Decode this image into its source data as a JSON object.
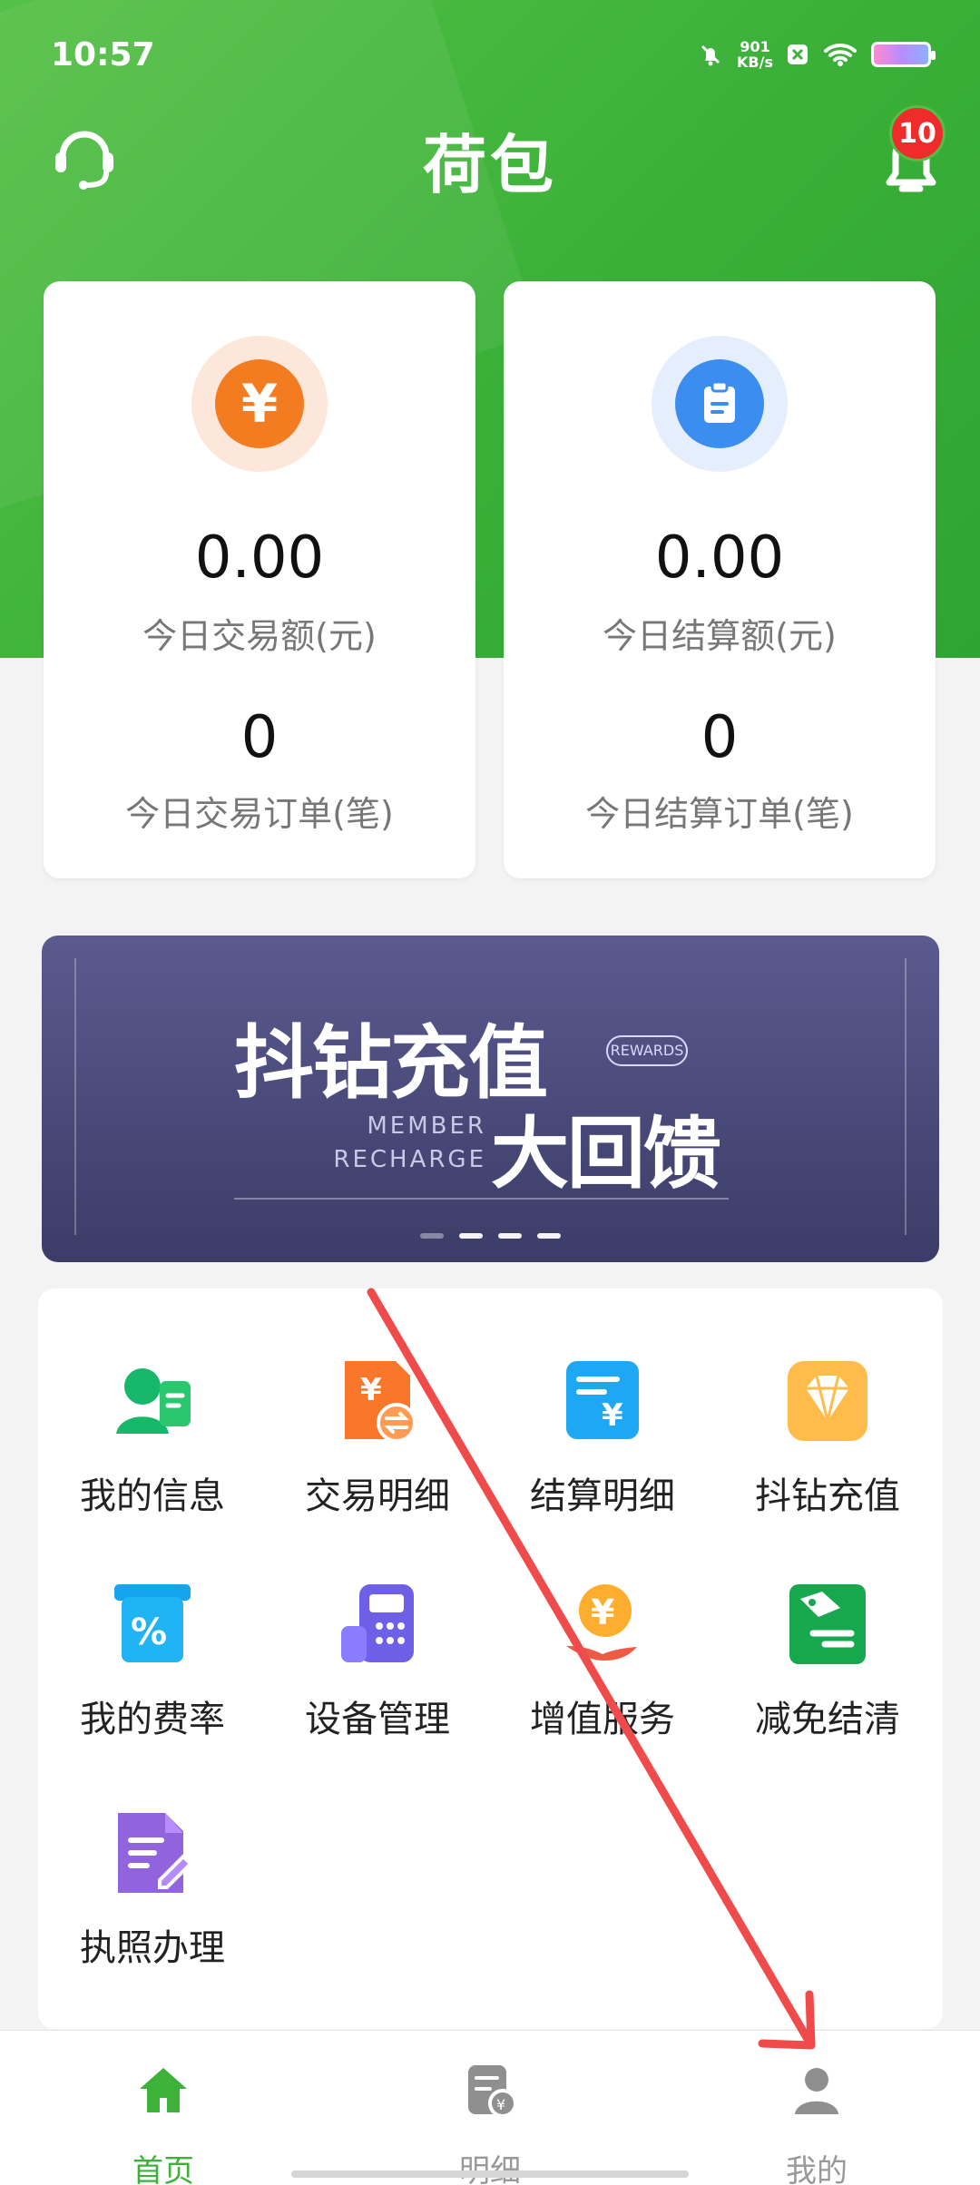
{
  "status_bar": {
    "time": "10:57",
    "network_speed_value": "901",
    "network_speed_unit": "KB/s"
  },
  "header": {
    "title": "荷包",
    "notification_count": "10",
    "support_icon": "headset-icon",
    "bell_icon": "bell-icon"
  },
  "summary_cards": [
    {
      "amount": "0.00",
      "amount_label": "今日交易额(元)",
      "count": "0",
      "count_label": "今日交易订单(笔)",
      "icon": "yuan-icon",
      "accent": "#f47c20"
    },
    {
      "amount": "0.00",
      "amount_label": "今日结算额(元)",
      "count": "0",
      "count_label": "今日结算订单(笔)",
      "icon": "clipboard-icon",
      "accent": "#3b8df0"
    }
  ],
  "banner": {
    "title": "抖钻充值",
    "subtitle": "大回馈",
    "english_line_1": "MEMBER",
    "english_line_2": "RECHARGE",
    "tag": "REWARDS",
    "active_slide": 1,
    "slide_count": 4
  },
  "menu": [
    {
      "label": "我的信息",
      "icon": "user-card-icon"
    },
    {
      "label": "交易明细",
      "icon": "transaction-detail-icon"
    },
    {
      "label": "结算明细",
      "icon": "settlement-detail-icon"
    },
    {
      "label": "抖钻充值",
      "icon": "diamond-icon"
    },
    {
      "label": "我的费率",
      "icon": "percentage-icon"
    },
    {
      "label": "设备管理",
      "icon": "pos-device-icon"
    },
    {
      "label": "增值服务",
      "icon": "value-added-service-icon"
    },
    {
      "label": "减免结清",
      "icon": "discount-tag-icon"
    },
    {
      "label": "执照办理",
      "icon": "license-document-icon"
    }
  ],
  "bottom_nav": [
    {
      "label": "首页",
      "icon": "home-icon",
      "active": true
    },
    {
      "label": "明细",
      "icon": "receipt-icon",
      "active": false
    },
    {
      "label": "我的",
      "icon": "profile-icon",
      "active": false
    }
  ],
  "colors": {
    "brand_green": "#3db13a",
    "annotation_arrow": "#f04b4b"
  }
}
